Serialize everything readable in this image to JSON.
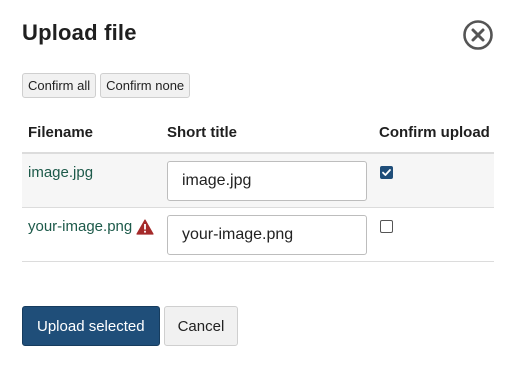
{
  "dialog": {
    "title": "Upload file",
    "close_icon": "close-circle-icon"
  },
  "toolbar": {
    "confirm_all_label": "Confirm all",
    "confirm_none_label": "Confirm none"
  },
  "table": {
    "headers": {
      "filename": "Filename",
      "short_title": "Short title",
      "confirm_upload": "Confirm upload"
    },
    "rows": [
      {
        "filename": "image.jpg",
        "short_title": "image.jpg",
        "confirmed": true,
        "warning": false
      },
      {
        "filename": "your-image.png",
        "short_title": "your-image.png",
        "confirmed": false,
        "warning": true,
        "warning_icon": "warning-triangle-icon"
      }
    ]
  },
  "footer": {
    "upload_label": "Upload selected",
    "cancel_label": "Cancel"
  },
  "colors": {
    "primary": "#1f4e79",
    "link": "#1d5a4a",
    "warning": "#a52a2a"
  }
}
